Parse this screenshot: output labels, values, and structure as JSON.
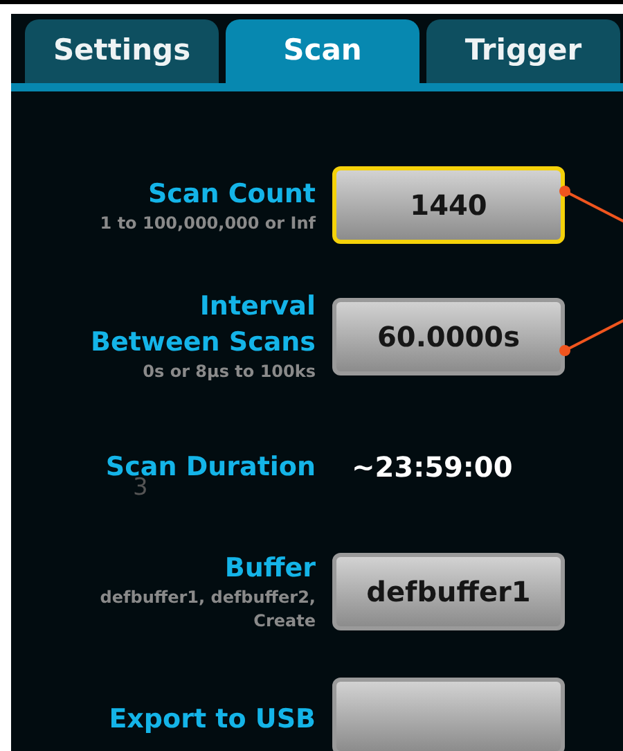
{
  "tabs": [
    {
      "label": "Settings",
      "selected": false
    },
    {
      "label": "Scan",
      "selected": true
    },
    {
      "label": "Trigger",
      "selected": false
    }
  ],
  "rows": [
    {
      "kind": "button",
      "label": "Scan Count",
      "hint": "1 to 100,000,000 or Inf",
      "value": "1440",
      "focused": true,
      "callout": true
    },
    {
      "kind": "button",
      "label": "Interval Between Scans",
      "hint": "0s or 8µs to 100ks",
      "value": "60.0000s",
      "focused": false,
      "callout": true
    },
    {
      "kind": "readout",
      "label": "Scan Duration",
      "value": "~23:59:00",
      "annotation": "3"
    },
    {
      "kind": "button",
      "label": "Buffer",
      "hint": "defbuffer1, defbuffer2, Create",
      "value": "defbuffer1",
      "focused": false,
      "callout": false
    },
    {
      "kind": "button",
      "label": "Export to USB",
      "focused": false,
      "callout": false
    }
  ]
}
